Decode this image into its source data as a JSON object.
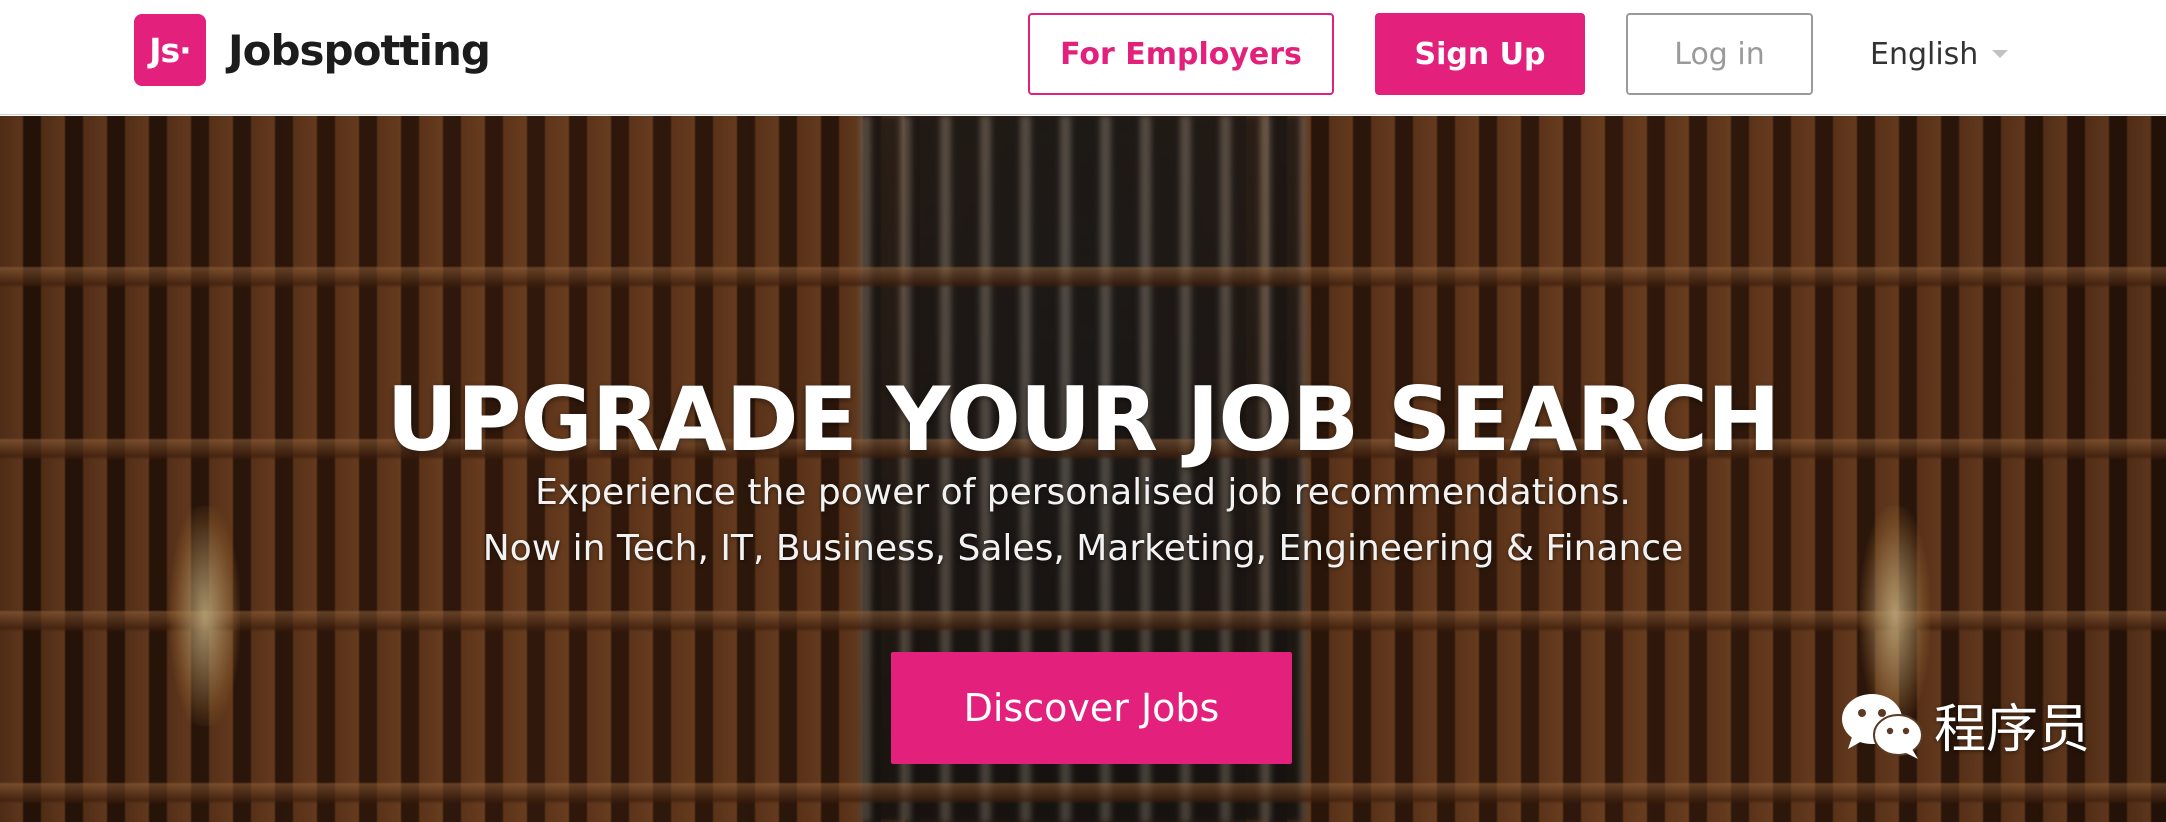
{
  "header": {
    "logo_mark": "Js·",
    "brand_name": "Jobspotting",
    "for_employers_label": "For Employers",
    "sign_up_label": "Sign Up",
    "log_in_label": "Log in",
    "language_label": "English"
  },
  "hero": {
    "title": "UPGRADE YOUR JOB SEARCH",
    "subtitle_line1": "Experience the power of personalised job recommendations.",
    "subtitle_line2": "Now in Tech, IT, Business, Sales, Marketing, Engineering & Finance",
    "cta_label": "Discover Jobs"
  },
  "watermark": {
    "text": "程序员",
    "icon": "wechat-icon"
  },
  "colors": {
    "accent": "#e3207b",
    "login_border": "#9a9a9a",
    "text_dark": "#1c1c1c"
  }
}
